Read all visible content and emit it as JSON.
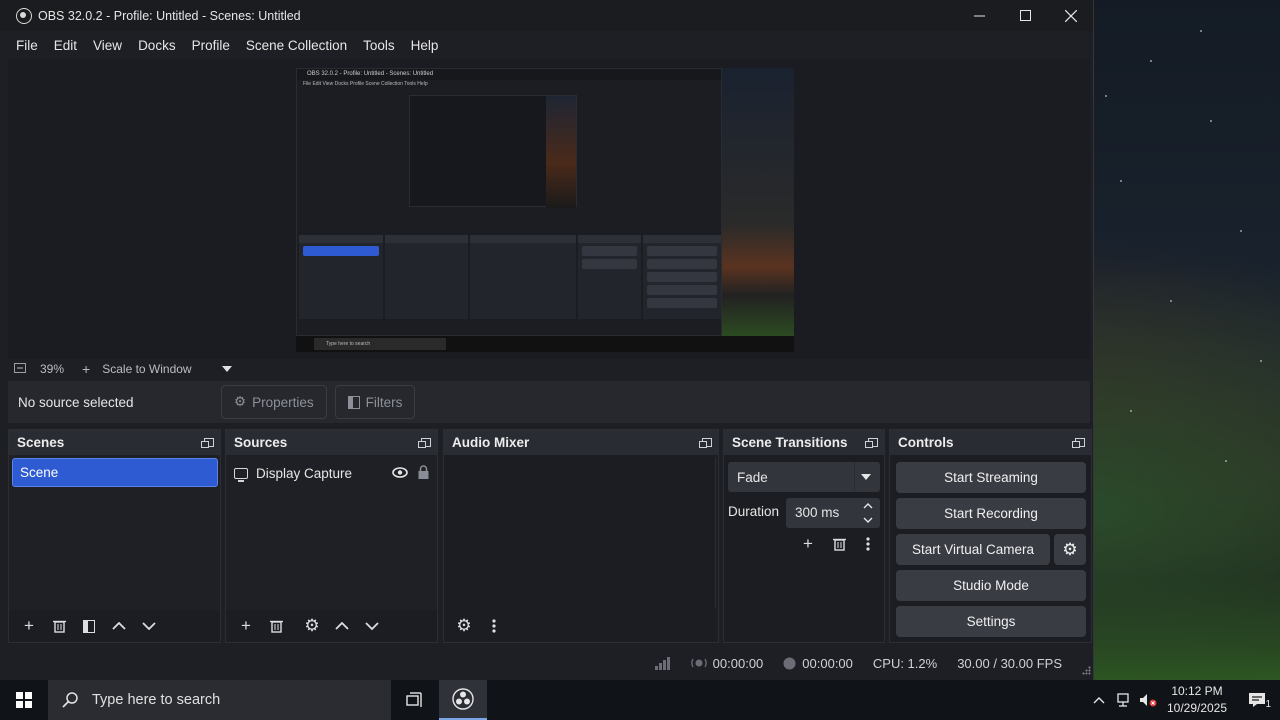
{
  "window": {
    "title": "OBS 32.0.2 - Profile: Untitled - Scenes: Untitled"
  },
  "menu": [
    "File",
    "Edit",
    "View",
    "Docks",
    "Profile",
    "Scene Collection",
    "Tools",
    "Help"
  ],
  "preview": {
    "zoom": "39%",
    "scale_mode": "Scale to Window",
    "nested_title": "OBS 32.0.2 - Profile: Untitled - Scenes: Untitled",
    "nested_search": "Type here to search"
  },
  "context": {
    "no_source": "No source selected",
    "properties": "Properties",
    "filters": "Filters"
  },
  "docks": {
    "scenes": {
      "title": "Scenes",
      "items": [
        "Scene"
      ]
    },
    "sources": {
      "title": "Sources",
      "items": [
        "Display Capture"
      ]
    },
    "mixer": {
      "title": "Audio Mixer"
    },
    "transitions": {
      "title": "Scene Transitions",
      "selected": "Fade",
      "duration_label": "Duration",
      "duration_value": "300 ms"
    },
    "controls": {
      "title": "Controls",
      "start_streaming": "Start Streaming",
      "start_recording": "Start Recording",
      "start_virtual_camera": "Start Virtual Camera",
      "studio_mode": "Studio Mode",
      "settings": "Settings"
    }
  },
  "status": {
    "stream_time": "00:00:00",
    "record_time": "00:00:00",
    "cpu": "CPU: 1.2%",
    "fps": "30.00 / 30.00 FPS"
  },
  "taskbar": {
    "search_placeholder": "Type here to search",
    "time": "10:12 PM",
    "date": "10/29/2025",
    "notification_count": "1"
  },
  "colors": {
    "accent": "#2f5bd2",
    "window_bg": "#1e1f24",
    "button_bg": "#3a3c44"
  }
}
